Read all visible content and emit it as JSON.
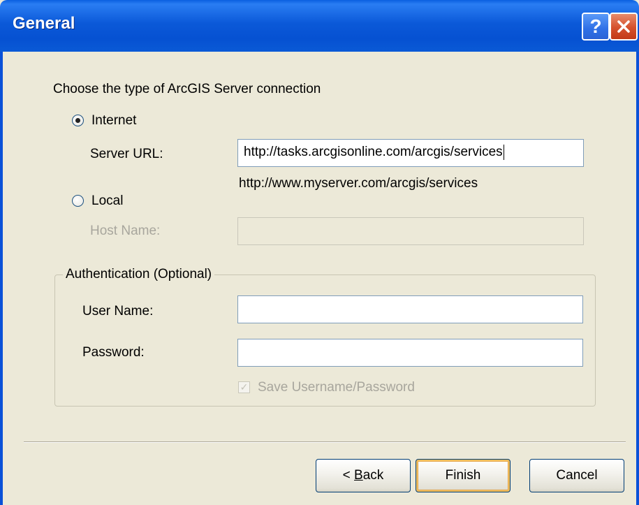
{
  "window": {
    "title": "General",
    "help_label": "?",
    "close_label": "✕"
  },
  "connection": {
    "prompt": "Choose the type of ArcGIS Server connection",
    "internet_label": "Internet",
    "internet_selected": true,
    "server_url_label": "Server URL:",
    "server_url_value": "http://tasks.arcgisonline.com/arcgis/services",
    "server_url_example": "http://www.myserver.com/arcgis/services",
    "local_label": "Local",
    "local_selected": false,
    "host_name_label": "Host Name:",
    "host_name_value": ""
  },
  "authentication": {
    "legend": "Authentication (Optional)",
    "user_name_label": "User Name:",
    "user_name_value": "",
    "password_label": "Password:",
    "password_value": "",
    "save_label": "Save Username/Password",
    "save_checked": true,
    "save_check_glyph": "✓"
  },
  "buttons": {
    "back_prefix": "< ",
    "back_mnemonic": "B",
    "back_rest": "ack",
    "finish": "Finish",
    "cancel": "Cancel"
  },
  "colors": {
    "title_bar": "#0a5ad6",
    "dialog_bg": "#ece9d8",
    "close_button": "#d5502c"
  }
}
